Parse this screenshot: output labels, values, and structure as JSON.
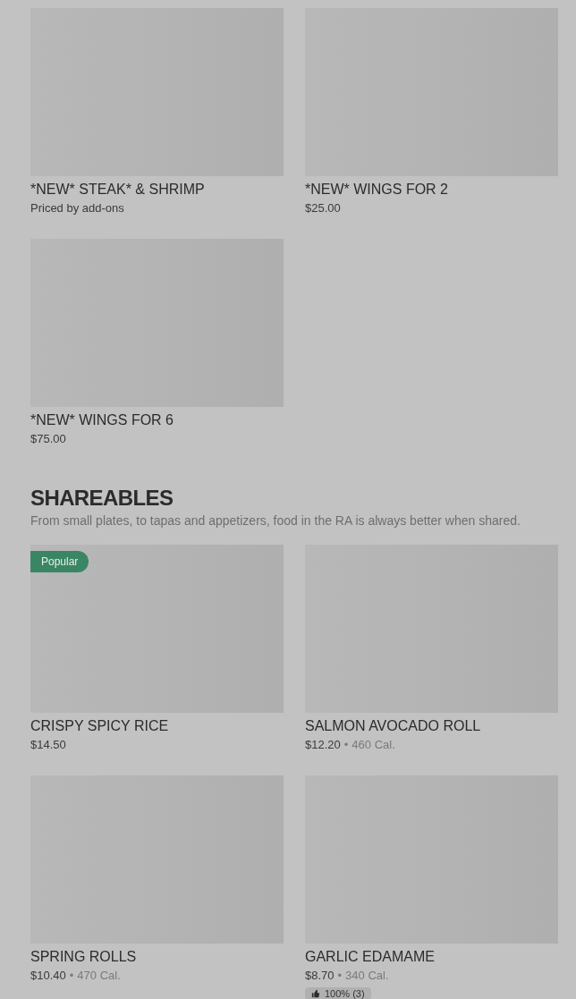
{
  "sections": [
    {
      "items": [
        {
          "name": "*NEW* STEAK* & SHRIMP",
          "price": "Priced by add-ons"
        },
        {
          "name": "*NEW* WINGS FOR 2",
          "price": "$25.00"
        },
        {
          "name": "*NEW* WINGS FOR 6",
          "price": "$75.00"
        }
      ]
    },
    {
      "title": "SHAREABLES",
      "description": "From small plates, to tapas and appetizers, food in the RA is always better when shared.",
      "items": [
        {
          "name": "CRISPY SPICY RICE",
          "price": "$14.50",
          "badge": "Popular"
        },
        {
          "name": "SALMON AVOCADO ROLL",
          "price": "$12.20",
          "separator": "•",
          "calories": "460 Cal."
        },
        {
          "name": "SPRING ROLLS",
          "price": "$10.40",
          "separator": "•",
          "calories": "470 Cal."
        },
        {
          "name": "GARLIC EDAMAME",
          "price": "$8.70",
          "separator": "•",
          "calories": "340 Cal.",
          "rating": "100% (3)"
        }
      ]
    }
  ]
}
